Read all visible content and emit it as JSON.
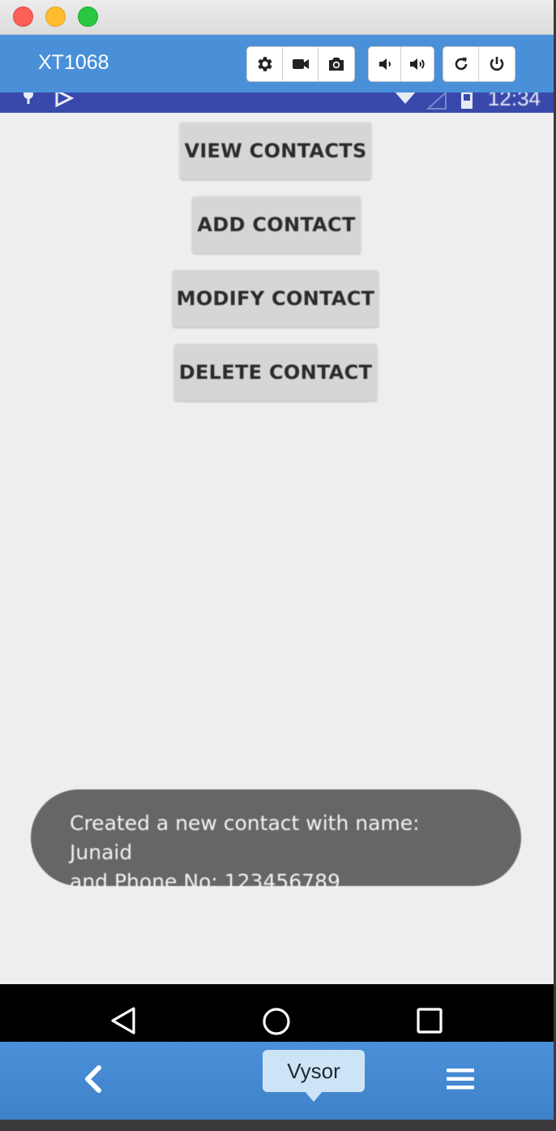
{
  "window": {
    "traffic_lights": [
      "close",
      "minimize",
      "maximize"
    ]
  },
  "toolbar": {
    "device_name": "XT1068",
    "icons": [
      "gear-icon",
      "video-camera-icon",
      "camera-icon",
      "volume-down-icon",
      "volume-up-icon",
      "rotate-icon",
      "power-icon"
    ],
    "background": "#4a90d9"
  },
  "statusbar": {
    "time": "12:34",
    "background": "#3949ab"
  },
  "app": {
    "buttons": [
      {
        "label": "VIEW CONTACTS"
      },
      {
        "label": "ADD CONTACT"
      },
      {
        "label": "MODIFY CONTACT"
      },
      {
        "label": "DELETE CONTACT"
      }
    ],
    "toast": {
      "line1": "Created a new contact with name: Junaid",
      "line2": "and Phone No: 123456789"
    }
  },
  "navbar": {
    "icons": [
      "back-triangle-icon",
      "home-circle-icon",
      "recents-square-icon"
    ]
  },
  "bottombar": {
    "tooltip": "Vysor",
    "icons": [
      "chevron-left-icon",
      "hamburger-menu-icon"
    ]
  }
}
